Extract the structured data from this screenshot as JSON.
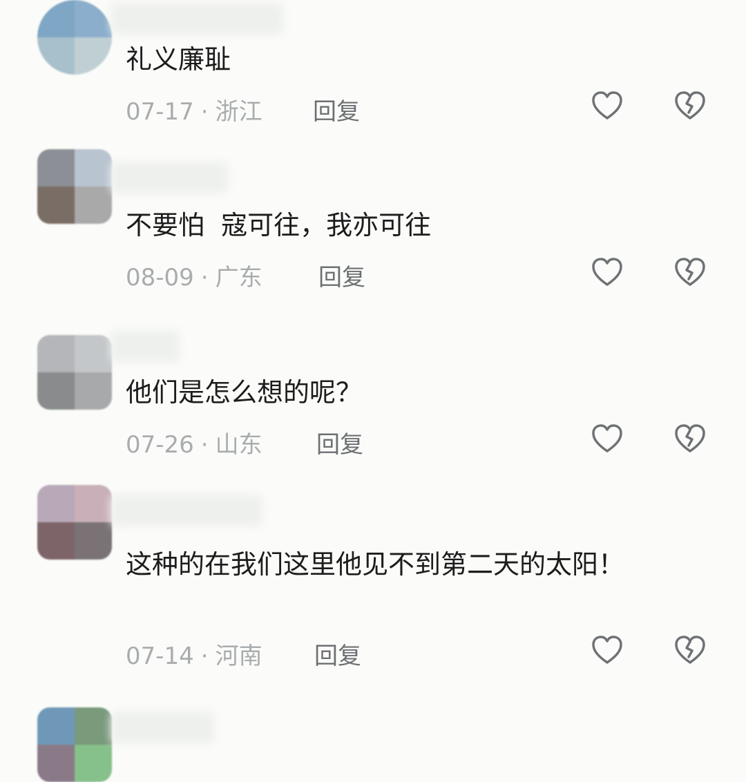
{
  "comments": [
    {
      "text": "礼义廉耻",
      "date": "07-17",
      "region": "浙江",
      "reply_label": "回复"
    },
    {
      "text": "不要怕  寇可往，我亦可往",
      "date": "08-09",
      "region": "广东",
      "reply_label": "回复"
    },
    {
      "text": "他们是怎么想的呢？",
      "date": "07-26",
      "region": "山东",
      "reply_label": "回复"
    },
    {
      "text": "这种的在我们这里他见不到第二天的太阳！",
      "date": "07-14",
      "region": "河南",
      "reply_label": "回复"
    }
  ],
  "separator": "·",
  "icons": {
    "like": "heart-outline-icon",
    "dislike": "broken-heart-icon"
  },
  "colors": {
    "text": "#1c1c1c",
    "meta": "#a9acae",
    "reply": "#6c6f72",
    "icon": "#6f7275"
  }
}
